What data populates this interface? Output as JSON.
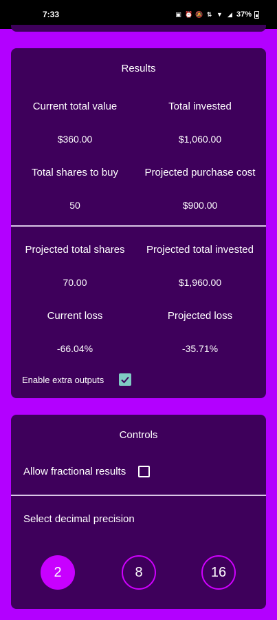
{
  "status_bar": {
    "time": "7:33",
    "battery": "37%"
  },
  "results": {
    "title": "Results",
    "current_total_value_label": "Current total value",
    "current_total_value": "$360.00",
    "total_invested_label": "Total invested",
    "total_invested": "$1,060.00",
    "total_shares_to_buy_label": "Total shares to buy",
    "total_shares_to_buy": "50",
    "projected_purchase_cost_label": "Projected purchase cost",
    "projected_purchase_cost": "$900.00",
    "projected_total_shares_label": "Projected total shares",
    "projected_total_shares": "70.00",
    "projected_total_invested_label": "Projected total invested",
    "projected_total_invested": "$1,960.00",
    "current_loss_label": "Current loss",
    "current_loss": "-66.04%",
    "projected_loss_label": "Projected loss",
    "projected_loss": "-35.71%",
    "enable_extra_outputs_label": "Enable extra outputs",
    "enable_extra_outputs_checked": true
  },
  "controls": {
    "title": "Controls",
    "allow_fractional_label": "Allow fractional results",
    "allow_fractional_checked": false,
    "precision_label": "Select decimal precision",
    "precision_options": [
      "2",
      "8",
      "16"
    ],
    "selected_precision": "2"
  },
  "colors": {
    "background": "#b300ff",
    "card": "#3e005b",
    "accent": "#c800ff",
    "checkbox": "#80cbc4"
  }
}
